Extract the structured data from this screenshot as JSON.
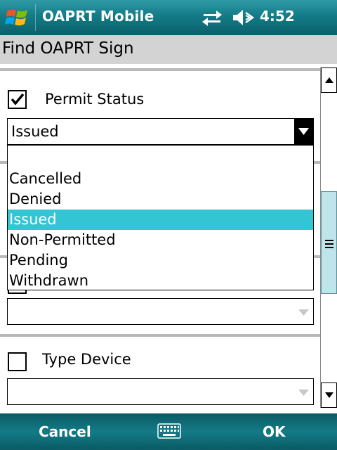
{
  "statusbar": {
    "app_title": "OAPRT Mobile",
    "time": "4:52",
    "icons": [
      "windows-start-icon",
      "connectivity-icon",
      "volume-muted-icon"
    ]
  },
  "titlebar": {
    "title": "Find OAPRT Sign"
  },
  "permit_status": {
    "label": "Permit Status",
    "checked": true,
    "selected_value": "Issued",
    "options": [
      "Cancelled",
      "Denied",
      "Issued",
      "Non-Permitted",
      "Pending",
      "Withdrawn"
    ],
    "selected_index": 2
  },
  "hidden_field": {
    "value": ""
  },
  "type_device": {
    "label": "Type Device",
    "checked": false,
    "value": ""
  },
  "softkeys": {
    "left": "Cancel",
    "right": "OK",
    "center_icon": "keyboard-icon"
  },
  "colors": {
    "status_bar": "#137b87",
    "selection": "#34c5d4",
    "title_bar": "#d3d3d3",
    "scroll_thumb": "#bfe4ea"
  }
}
